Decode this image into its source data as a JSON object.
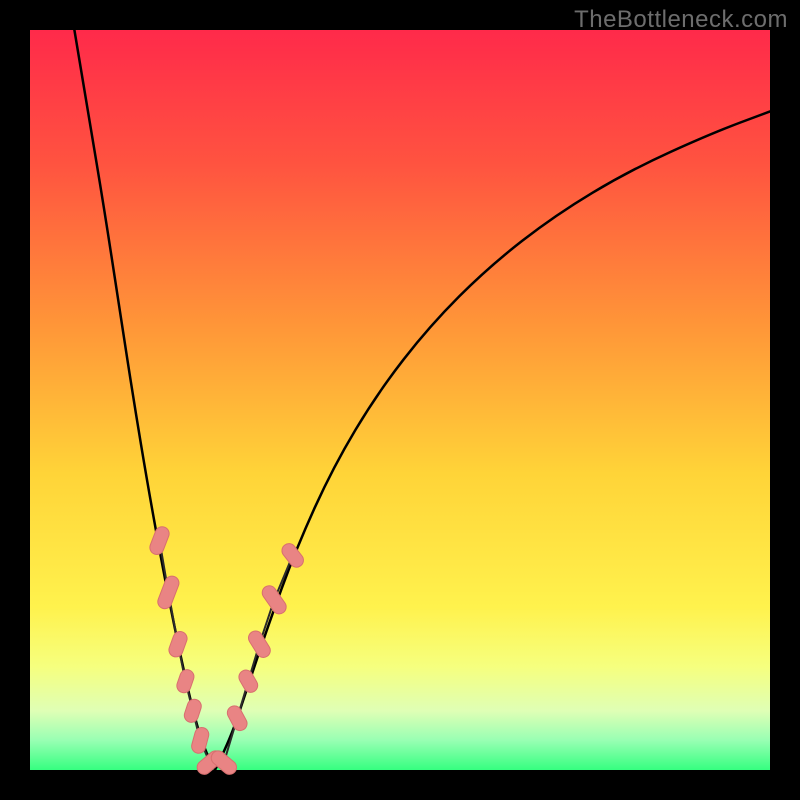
{
  "watermark": "TheBottleneck.com",
  "colors": {
    "frame": "#000000",
    "curve": "#000000",
    "bead_fill": "#e98484",
    "bead_stroke": "#d86f6f",
    "spine_stroke": "#2b2b2b",
    "gradient_stops": [
      {
        "offset": 0.0,
        "color": "#ff2a4a"
      },
      {
        "offset": 0.18,
        "color": "#ff5340"
      },
      {
        "offset": 0.4,
        "color": "#ff9638"
      },
      {
        "offset": 0.6,
        "color": "#ffd438"
      },
      {
        "offset": 0.78,
        "color": "#fff24d"
      },
      {
        "offset": 0.86,
        "color": "#f6ff7e"
      },
      {
        "offset": 0.92,
        "color": "#dfffb5"
      },
      {
        "offset": 0.96,
        "color": "#98ffb3"
      },
      {
        "offset": 1.0,
        "color": "#35ff80"
      }
    ]
  },
  "chart_data": {
    "type": "line",
    "title": "",
    "xlabel": "",
    "ylabel": "",
    "xlim": [
      0,
      100
    ],
    "ylim": [
      0,
      100
    ],
    "series": [
      {
        "name": "bottleneck-curve-left",
        "x": [
          6,
          8,
          10,
          12,
          14,
          16,
          18,
          20,
          22,
          23.5,
          25
        ],
        "y": [
          100,
          88,
          76,
          63,
          50,
          38,
          27,
          17,
          8,
          3,
          0
        ]
      },
      {
        "name": "bottleneck-curve-right",
        "x": [
          25,
          27,
          29,
          32,
          36,
          41,
          47,
          54,
          62,
          71,
          81,
          92,
          100
        ],
        "y": [
          0,
          4,
          10,
          19,
          30,
          41,
          51,
          60,
          68,
          75,
          81,
          86,
          89
        ]
      }
    ],
    "markers": {
      "name": "gpu-samples",
      "note": "Estimated positions of the salmon bead markers along the curve. lx/ly are percent x and bottleneck% y. Each bead is a rounded lozenge centered on the point, rotated to follow the curve's local tangent.",
      "points": [
        {
          "x": 17.5,
          "y": 31,
          "len": 8,
          "angle": -69
        },
        {
          "x": 18.7,
          "y": 24,
          "len": 10,
          "angle": -69
        },
        {
          "x": 20.0,
          "y": 17,
          "len": 7,
          "angle": -70
        },
        {
          "x": 21.0,
          "y": 12,
          "len": 6,
          "angle": -71
        },
        {
          "x": 22.0,
          "y": 8,
          "len": 6,
          "angle": -72
        },
        {
          "x": 23.0,
          "y": 4,
          "len": 7,
          "angle": -75
        },
        {
          "x": 24.3,
          "y": 1,
          "len": 8,
          "angle": -40
        },
        {
          "x": 26.2,
          "y": 1,
          "len": 8,
          "angle": 40
        },
        {
          "x": 28.0,
          "y": 7,
          "len": 7,
          "angle": 62
        },
        {
          "x": 29.5,
          "y": 12,
          "len": 6,
          "angle": 60
        },
        {
          "x": 31.0,
          "y": 17,
          "len": 8,
          "angle": 58
        },
        {
          "x": 33.0,
          "y": 23,
          "len": 9,
          "angle": 55
        },
        {
          "x": 35.5,
          "y": 29,
          "len": 7,
          "angle": 52
        }
      ]
    }
  }
}
